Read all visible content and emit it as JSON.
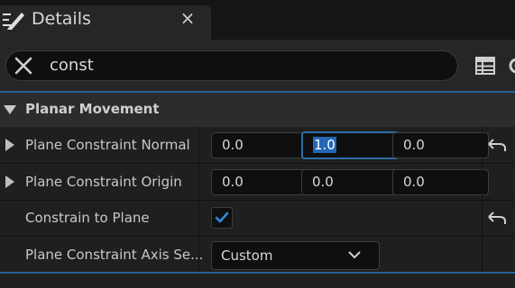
{
  "tab": {
    "title": "Details",
    "close_glyph": "×",
    "icon": "pencil-icon"
  },
  "search": {
    "value": "const",
    "placeholder": ""
  },
  "toolbar": {
    "icons": [
      "table-icon",
      "gear-icon"
    ]
  },
  "colors": {
    "accent": "#2b5f95",
    "selection": "#2367b6",
    "checkmark": "#2f8ae0"
  },
  "category": {
    "title": "Planar Movement",
    "expanded": true
  },
  "rows": {
    "normal": {
      "label": "Plane Constraint Normal",
      "x": "0.0",
      "y": "1.0",
      "z": "0.0",
      "focused_field": "y",
      "has_reset": true
    },
    "origin": {
      "label": "Plane Constraint Origin",
      "x": "0.0",
      "y": "0.0",
      "z": "0.0",
      "has_reset": false
    },
    "constrain": {
      "label": "Constrain to Plane",
      "checked": true,
      "has_reset": true
    },
    "axis": {
      "label": "Plane Constraint Axis Se...",
      "value": "Custom"
    }
  }
}
